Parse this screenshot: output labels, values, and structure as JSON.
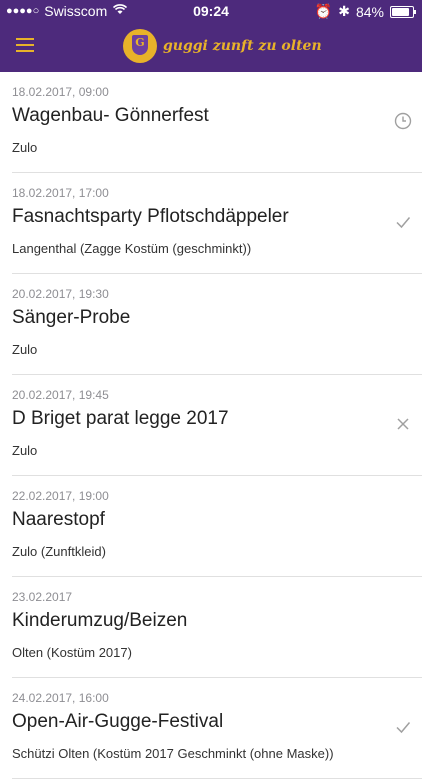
{
  "status_bar": {
    "signal": "●●●●○",
    "carrier": "Swisscom",
    "time": "09:24",
    "battery": "84%",
    "battery_level": 0.84
  },
  "header": {
    "logo_text": "guggi zunft zu olten",
    "crest_letter": "G"
  },
  "events": [
    {
      "date": "18.02.2017, 09:00",
      "title": "Wagenbau- Gönnerfest",
      "location": "Zulo",
      "status": "clock-icon"
    },
    {
      "date": "18.02.2017, 17:00",
      "title": "Fasnachtsparty Pflotschdäppeler",
      "location": "Langenthal (Zagge Kostüm (geschminkt))",
      "status": "check-icon"
    },
    {
      "date": "20.02.2017, 19:30",
      "title": "Sänger-Probe",
      "location": "Zulo",
      "status": "none"
    },
    {
      "date": "20.02.2017, 19:45",
      "title": "D Briget parat legge 2017",
      "location": "Zulo",
      "status": "cross-icon"
    },
    {
      "date": "22.02.2017, 19:00",
      "title": "Naarestopf",
      "location": "Zulo (Zunftkleid)",
      "status": "none"
    },
    {
      "date": "23.02.2017",
      "title": "Kinderumzug/Beizen",
      "location": "Olten (Kostüm 2017)",
      "status": "none"
    },
    {
      "date": "24.02.2017, 16:00",
      "title": "Open-Air-Gugge-Festival",
      "location": "Schützi Olten (Kostüm 2017 Geschminkt (ohne Maske))",
      "status": "check-icon"
    }
  ],
  "colors": {
    "brand": "#4d2a7c",
    "accent": "#e8b22a",
    "status_icon": "#a0a0a0"
  }
}
